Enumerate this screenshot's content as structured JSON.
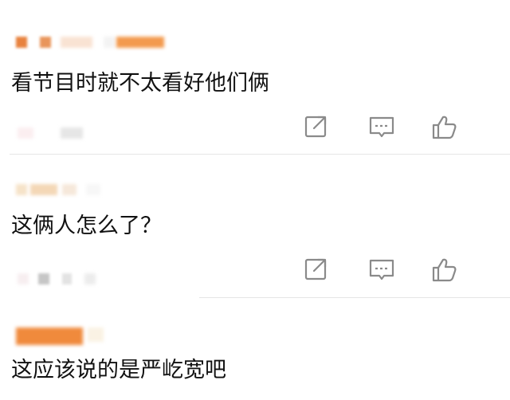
{
  "comments": [
    {
      "text": "看节目时就不太看好他们俩"
    },
    {
      "text": "这俩人怎么了？"
    },
    {
      "text": "这应该说的是严屹宽吧"
    }
  ],
  "icons": {
    "share": "share-icon",
    "comment": "comment-icon",
    "like": "thumbs-up-icon"
  },
  "colors": {
    "text": "#111111",
    "icon": "#8a8a8a",
    "divider": "#e6e6e6",
    "blur_orange": "#f08a3c",
    "blur_peach": "#f6c7a4",
    "blur_gray": "#d6d6d6"
  }
}
